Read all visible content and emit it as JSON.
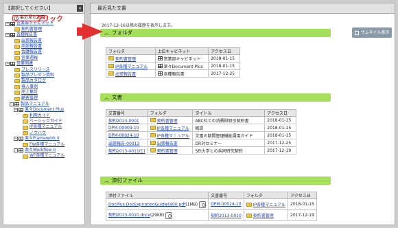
{
  "left": {
    "title": "【選択してください】",
    "collapse": "«",
    "tree": [
      {
        "pm": "",
        "icon": "clock",
        "label": "最近見た文書",
        "indent": 0,
        "link": false,
        "recent": true
      },
      {
        "pm": "−",
        "icon": "grid",
        "label": "営業部キャビネット",
        "indent": 0,
        "link": true
      },
      {
        "pm": "",
        "icon": "folder",
        "label": "契約書管理",
        "indent": 1,
        "link": true
      },
      {
        "pm": "−",
        "icon": "grid",
        "label": "各種報告書",
        "indent": 0,
        "link": true
      },
      {
        "pm": "",
        "icon": "folder",
        "label": "出張報告書",
        "indent": 1,
        "link": true
      },
      {
        "pm": "",
        "icon": "folder",
        "label": "商談報告書",
        "indent": 1,
        "link": true
      },
      {
        "pm": "",
        "icon": "folder",
        "label": "会議報告書",
        "indent": 1,
        "link": true
      },
      {
        "pm": "",
        "icon": "folder",
        "label": "営業週報",
        "indent": 1,
        "link": true
      },
      {
        "pm": "−",
        "icon": "grid",
        "label": "営業関連",
        "indent": 0,
        "link": true
      },
      {
        "pm": "",
        "icon": "folder",
        "label": "プレスリリース",
        "indent": 1,
        "link": true
      },
      {
        "pm": "",
        "icon": "folder",
        "label": "製品プレゼン資料",
        "indent": 1,
        "link": true
      },
      {
        "pm": "",
        "icon": "folder",
        "label": "製品カタログ",
        "indent": 1,
        "link": true
      },
      {
        "pm": "",
        "icon": "folder",
        "label": "導入事例",
        "indent": 1,
        "link": true
      },
      {
        "pm": "",
        "icon": "folder",
        "label": "売上集計",
        "indent": 1,
        "link": true
      },
      {
        "pm": "",
        "icon": "folder",
        "label": "顧客管理",
        "indent": 1,
        "link": true
      },
      {
        "pm": "−",
        "icon": "grid",
        "label": "製品マニュアル",
        "indent": 1,
        "link": true
      },
      {
        "pm": "−",
        "icon": "grid",
        "label": "楽々Document Plus",
        "indent": 2,
        "link": true
      },
      {
        "pm": "",
        "icon": "folder",
        "label": "利用ガイド",
        "indent": 3,
        "link": true
      },
      {
        "pm": "",
        "icon": "folder",
        "label": "ベーシックガイド",
        "indent": 3,
        "link": true
      },
      {
        "pm": "",
        "icon": "folder",
        "label": "IP各種マニュアル",
        "indent": 3,
        "link": true
      },
      {
        "pm": "",
        "icon": "folder",
        "label": "ノウハウ",
        "indent": 3,
        "link": true
      },
      {
        "pm": "−",
        "icon": "grid",
        "label": "楽々Framework II",
        "indent": 2,
        "link": true
      },
      {
        "pm": "",
        "icon": "folder",
        "label": "FW各種マニュアル",
        "indent": 3,
        "link": true
      },
      {
        "pm": "−",
        "icon": "grid",
        "label": "楽々Workflow II",
        "indent": 2,
        "link": true
      },
      {
        "pm": "",
        "icon": "folder",
        "label": "WF各種マニュアル",
        "indent": 3,
        "link": true
      }
    ]
  },
  "right": {
    "title": "最近見た文書",
    "description": "2017-12-16以降の履歴を表示します。",
    "thumbnail_button": "サムネイル表示",
    "folders": {
      "heading": "フォルダ",
      "headers": [
        "フォルダ",
        "上位キャビネット",
        "アクセス日"
      ],
      "rows": [
        [
          "契約書管理",
          "営業部キャビネット",
          "2018-01-15"
        ],
        [
          "IP各種マニュアル",
          "楽々Document Plus",
          "2018-01-15"
        ],
        [
          "出張報告書",
          "各種報告書",
          "2017-12-25"
        ]
      ]
    },
    "documents": {
      "heading": "文書",
      "headers": [
        "文書番号",
        "フォルダ",
        "タイトル",
        "アクセス日"
      ],
      "rows": [
        [
          "契約2013-0001",
          "契約書管理",
          "ABC社との消費財取引契約書",
          "2018-01-15"
        ],
        [
          "DPM-00009-10",
          "IP各種マニュアル",
          "概説",
          "2018-01-15"
        ],
        [
          "DPM-00024-10",
          "IP各種マニュアル",
          "文書の期間管理機能運用ガイド",
          "2018-01-15"
        ],
        [
          "出張報告-00013",
          "出張報告書",
          "DR対セミナー",
          "2017-12-25"
        ],
        [
          "契約2013-0011(C)",
          "契約書管理",
          "SEI大学との共同研究契約",
          "2017-12-19"
        ]
      ]
    },
    "attachments": {
      "heading": "添付ファイル",
      "headers": [
        "添付ファイル",
        "文書番号",
        "フォルダ",
        "アクセス日"
      ],
      "rows": [
        [
          "DocPlus DocExpirationGuide4400.pdf",
          "(1MB)",
          "DPM-00024-10",
          "IP各種マニュアル",
          "2018-01-15"
        ],
        [
          "契約2013-0010.docx",
          "(29KB)",
          "契約2013-0010",
          "契約書管理",
          "2017-12-19"
        ]
      ]
    }
  },
  "annotation": {
    "callout": "クリック"
  }
}
